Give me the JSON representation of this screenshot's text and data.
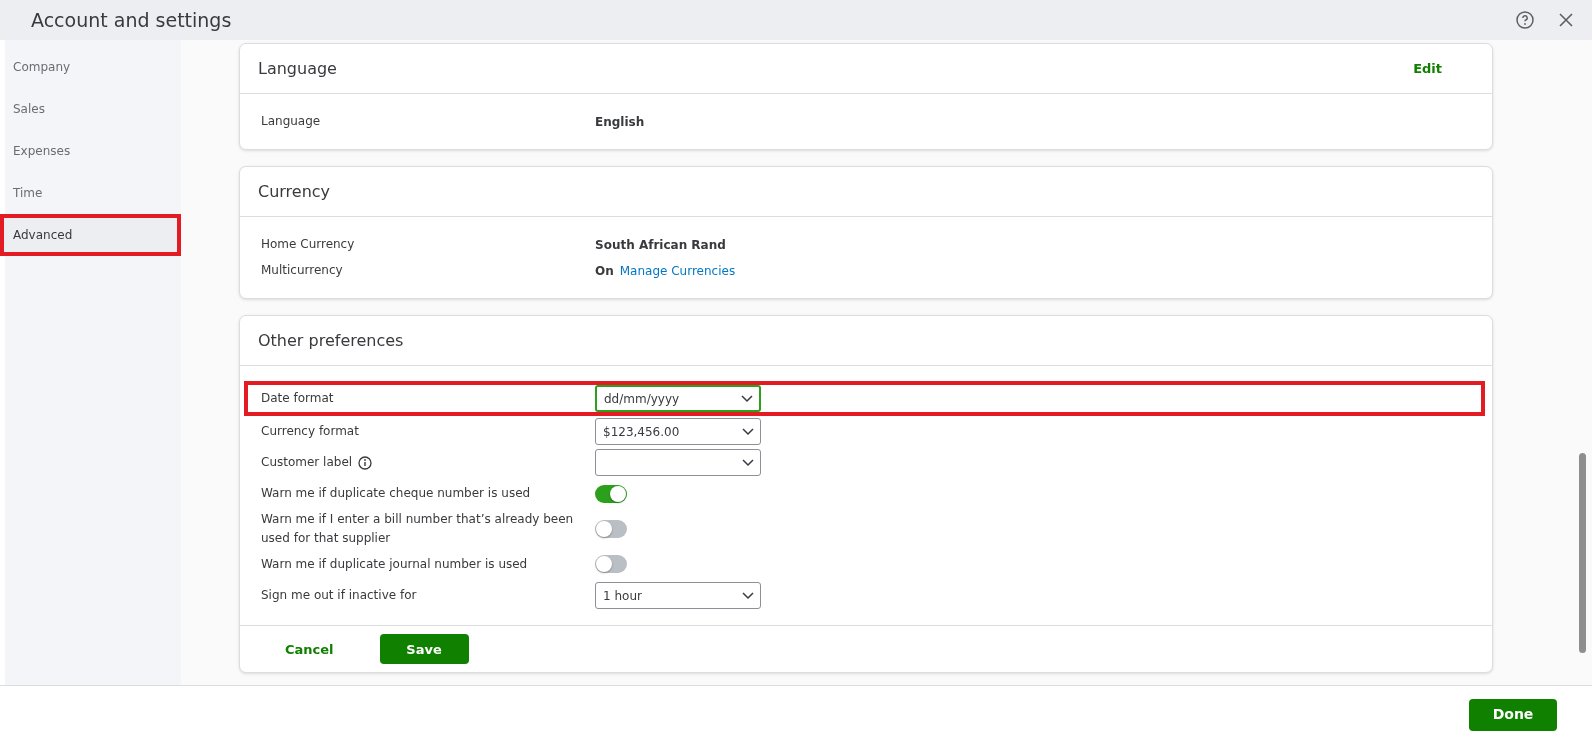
{
  "window": {
    "title": "Account and settings"
  },
  "sidebar": {
    "items": [
      {
        "label": "Company",
        "selected": false,
        "highlighted": false
      },
      {
        "label": "Sales",
        "selected": false,
        "highlighted": false
      },
      {
        "label": "Expenses",
        "selected": false,
        "highlighted": false
      },
      {
        "label": "Time",
        "selected": false,
        "highlighted": false
      },
      {
        "label": "Advanced",
        "selected": true,
        "highlighted": true
      }
    ]
  },
  "sections": [
    {
      "title": "Language",
      "action": "Edit",
      "rows": [
        {
          "kind": "text",
          "label": "Language",
          "value": "English"
        }
      ]
    },
    {
      "title": "Currency",
      "rows": [
        {
          "kind": "text",
          "label": "Home Currency",
          "value": "South African Rand"
        },
        {
          "kind": "text",
          "label": "Multicurrency",
          "value": "On",
          "link": "Manage Currencies"
        }
      ]
    },
    {
      "title": "Other preferences",
      "rows": [
        {
          "kind": "select",
          "label": "Date format",
          "value": "dd/mm/yyyy",
          "focused": true,
          "highlighted": true,
          "info": false
        },
        {
          "kind": "select",
          "label": "Currency format",
          "value": "$123,456.00",
          "focused": false,
          "highlighted": false,
          "info": false
        },
        {
          "kind": "select",
          "label": "Customer label",
          "focused": false,
          "highlighted": false,
          "info": true
        },
        {
          "kind": "toggle",
          "label": "Warn me if duplicate cheque number is used",
          "on": true,
          "highlighted": false,
          "info": false
        },
        {
          "kind": "toggle",
          "label": "Warn me if I enter a bill number that’s already been used for that supplier",
          "on": false,
          "highlighted": false,
          "info": false
        },
        {
          "kind": "toggle",
          "label": "Warn me if duplicate journal number is used",
          "on": false,
          "highlighted": false,
          "info": false
        },
        {
          "kind": "select",
          "label": "Sign me out if inactive for",
          "value": "1 hour",
          "focused": false,
          "highlighted": false,
          "info": false
        }
      ],
      "buttons": {
        "cancel": "Cancel",
        "save": "Save"
      }
    }
  ],
  "footer": {
    "done": "Done"
  }
}
